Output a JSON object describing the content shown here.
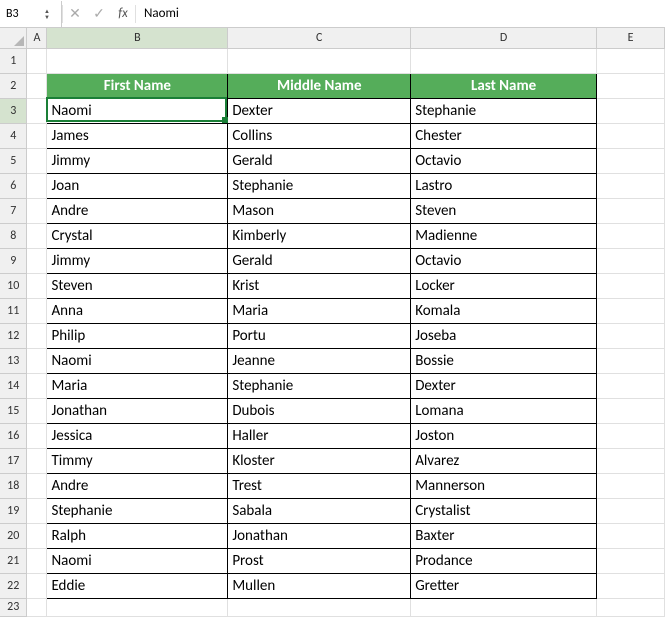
{
  "formula_bar": {
    "name_box": "B3",
    "fx_label": "fx",
    "formula": "Naomi"
  },
  "columns": {
    "A": "A",
    "B": "B",
    "C": "C",
    "D": "D",
    "E": "E"
  },
  "rows": [
    "1",
    "2",
    "3",
    "4",
    "5",
    "6",
    "7",
    "8",
    "9",
    "10",
    "11",
    "12",
    "13",
    "14",
    "15",
    "16",
    "17",
    "18",
    "19",
    "20",
    "21",
    "22",
    "23"
  ],
  "active": {
    "col": "B",
    "row": "3"
  },
  "headers": {
    "first": "First Name",
    "middle": "Middle Name",
    "last": "Last Name"
  },
  "table": [
    {
      "first": "Naomi",
      "middle": "Dexter",
      "last": "Stephanie"
    },
    {
      "first": "James",
      "middle": "Collins",
      "last": "Chester"
    },
    {
      "first": "Jimmy",
      "middle": "Gerald",
      "last": "Octavio"
    },
    {
      "first": "Joan",
      "middle": "Stephanie",
      "last": "Lastro"
    },
    {
      "first": "Andre",
      "middle": "Mason",
      "last": "Steven"
    },
    {
      "first": "Crystal",
      "middle": "Kimberly",
      "last": "Madienne"
    },
    {
      "first": "Jimmy",
      "middle": "Gerald",
      "last": "Octavio"
    },
    {
      "first": "Steven",
      "middle": "Krist",
      "last": "Locker"
    },
    {
      "first": "Anna",
      "middle": "Maria",
      "last": "Komala"
    },
    {
      "first": "Philip",
      "middle": "Portu",
      "last": "Joseba"
    },
    {
      "first": "Naomi",
      "middle": "Jeanne",
      "last": "Bossie"
    },
    {
      "first": "Maria",
      "middle": "Stephanie",
      "last": "Dexter"
    },
    {
      "first": "Jonathan",
      "middle": "Dubois",
      "last": "Lomana"
    },
    {
      "first": "Jessica",
      "middle": "Haller",
      "last": "Joston"
    },
    {
      "first": "Timmy",
      "middle": "Kloster",
      "last": "Alvarez"
    },
    {
      "first": "Andre",
      "middle": "Trest",
      "last": "Mannerson"
    },
    {
      "first": "Stephanie",
      "middle": "Sabala",
      "last": "Crystalist"
    },
    {
      "first": "Ralph",
      "middle": "Jonathan",
      "last": "Baxter"
    },
    {
      "first": "Naomi",
      "middle": "Prost",
      "last": "Prodance"
    },
    {
      "first": "Eddie",
      "middle": "Mullen",
      "last": "Gretter"
    }
  ],
  "chart_data": {
    "type": "table",
    "columns": [
      "First Name",
      "Middle Name",
      "Last Name"
    ],
    "rows": [
      [
        "Naomi",
        "Dexter",
        "Stephanie"
      ],
      [
        "James",
        "Collins",
        "Chester"
      ],
      [
        "Jimmy",
        "Gerald",
        "Octavio"
      ],
      [
        "Joan",
        "Stephanie",
        "Lastro"
      ],
      [
        "Andre",
        "Mason",
        "Steven"
      ],
      [
        "Crystal",
        "Kimberly",
        "Madienne"
      ],
      [
        "Jimmy",
        "Gerald",
        "Octavio"
      ],
      [
        "Steven",
        "Krist",
        "Locker"
      ],
      [
        "Anna",
        "Maria",
        "Komala"
      ],
      [
        "Philip",
        "Portu",
        "Joseba"
      ],
      [
        "Naomi",
        "Jeanne",
        "Bossie"
      ],
      [
        "Maria",
        "Stephanie",
        "Dexter"
      ],
      [
        "Jonathan",
        "Dubois",
        "Lomana"
      ],
      [
        "Jessica",
        "Haller",
        "Joston"
      ],
      [
        "Timmy",
        "Kloster",
        "Alvarez"
      ],
      [
        "Andre",
        "Trest",
        "Mannerson"
      ],
      [
        "Stephanie",
        "Sabala",
        "Crystalist"
      ],
      [
        "Ralph",
        "Jonathan",
        "Baxter"
      ],
      [
        "Naomi",
        "Prost",
        "Prodance"
      ],
      [
        "Eddie",
        "Mullen",
        "Gretter"
      ]
    ]
  }
}
